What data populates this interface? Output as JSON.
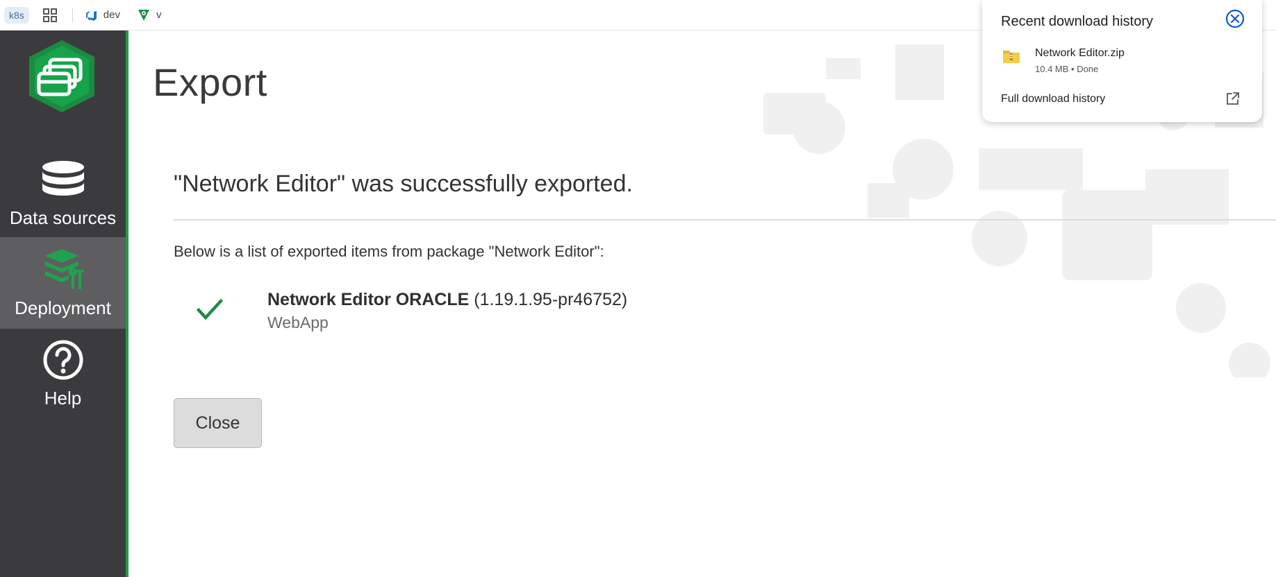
{
  "bookmarks": {
    "k8s": "k8s",
    "apps_icon": "apps-grid-icon",
    "dev_label": "dev",
    "v_label": "v"
  },
  "sidebar": {
    "items": [
      {
        "label": "Data sources",
        "icon": "database-icon",
        "active": false
      },
      {
        "label": "Deployment",
        "icon": "layers-tools-icon",
        "active": true
      },
      {
        "label": "Help",
        "icon": "question-icon",
        "active": false
      }
    ]
  },
  "main": {
    "title": "Export",
    "success_heading": "\"Network Editor\" was successfully exported.",
    "list_intro": "Below is a list of exported items from package \"Network Editor\":",
    "items": [
      {
        "name": "Network Editor ORACLE",
        "version": "(1.19.1.95-pr46752)",
        "type": "WebApp",
        "status_icon": "checkmark-icon"
      }
    ],
    "close_label": "Close"
  },
  "download_popup": {
    "title": "Recent download history",
    "file_name": "Network Editor.zip",
    "file_status": "10.4 MB • Done",
    "full_history": "Full download history"
  },
  "colors": {
    "sidebar_bg": "#3b3b3e",
    "sidebar_active": "#5e5e61",
    "accent_green": "#1e9b4a",
    "close_icon_blue": "#0b57d0"
  }
}
